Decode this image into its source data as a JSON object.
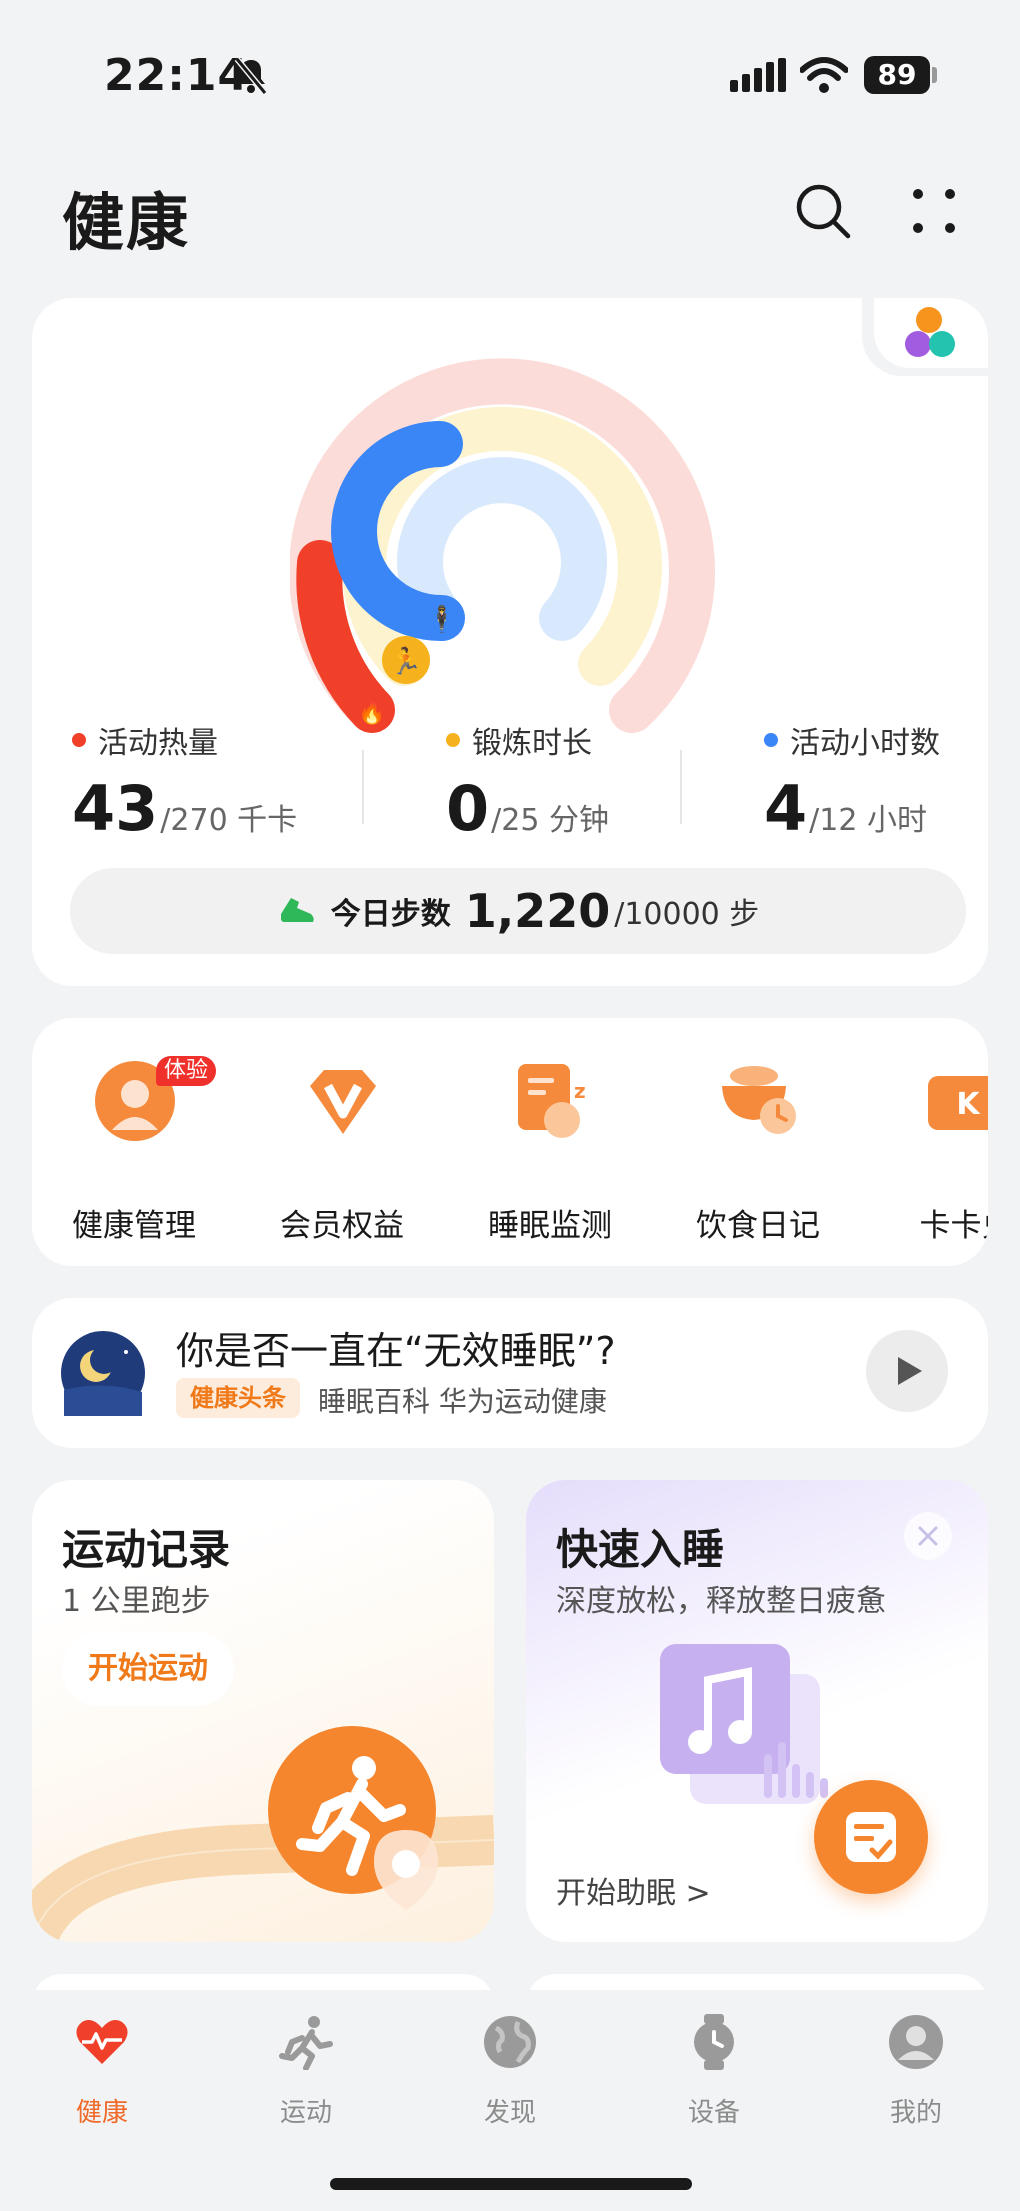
{
  "status_bar": {
    "time": "22:14",
    "battery": "89"
  },
  "header": {
    "title": "健康"
  },
  "activity": {
    "stats": [
      {
        "label": "活动热量",
        "value": "43",
        "goal": "/270 千卡",
        "color": "#f0402a"
      },
      {
        "label": "锻炼时长",
        "value": "0",
        "goal": "/25 分钟",
        "color": "#f6b21d"
      },
      {
        "label": "活动小时数",
        "value": "4",
        "goal": "/12 小时",
        "color": "#3b86f6"
      }
    ],
    "steps": {
      "label": "今日步数",
      "count": "1,220",
      "goal": "/10000 步"
    }
  },
  "shortcuts": [
    {
      "label": "健康管理",
      "badge": "体验"
    },
    {
      "label": "会员权益"
    },
    {
      "label": "睡眠监测"
    },
    {
      "label": "饮食日记"
    },
    {
      "label": "卡卡兑"
    }
  ],
  "article": {
    "title": "你是否一直在“无效睡眠”?",
    "tag": "健康头条",
    "meta": "睡眠百科 华为运动健康"
  },
  "tiles": {
    "exercise": {
      "title": "运动记录",
      "subtitle": "1 公里跑步",
      "button": "开始运动"
    },
    "sleep": {
      "title": "快速入睡",
      "subtitle": "深度放松，释放整日疲惫",
      "link": "开始助眠 >"
    }
  },
  "nav": [
    {
      "label": "健康",
      "icon": "heart-pulse-icon",
      "active": true
    },
    {
      "label": "运动",
      "icon": "runner-icon"
    },
    {
      "label": "发现",
      "icon": "globe-icon"
    },
    {
      "label": "设备",
      "icon": "watch-icon"
    },
    {
      "label": "我的",
      "icon": "person-icon"
    }
  ],
  "colors": {
    "accent": "#f06a2a",
    "calories": "#f0402a",
    "exercise": "#f6b21d",
    "hours": "#3b86f6"
  }
}
